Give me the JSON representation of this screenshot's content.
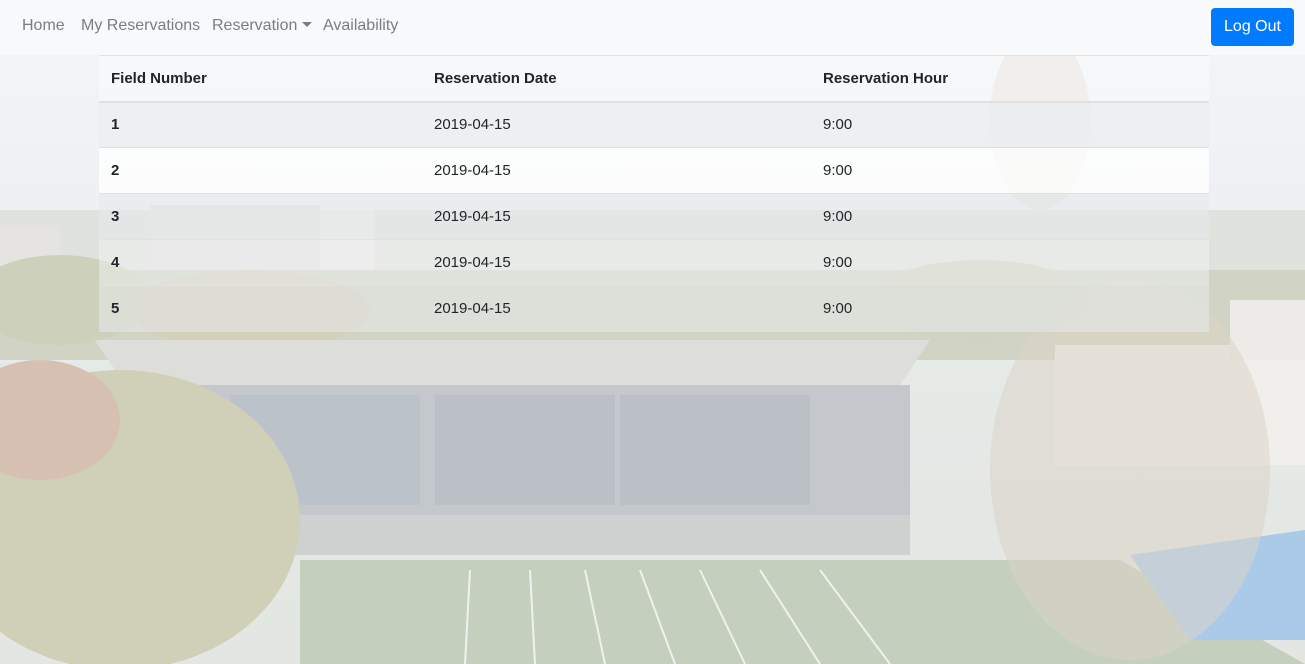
{
  "nav": {
    "home": "Home",
    "my_reservations": "My Reservations",
    "reservation": "Reservation",
    "availability": "Availability",
    "logout": "Log Out"
  },
  "table": {
    "headers": [
      "Field Number",
      "Reservation Date",
      "Reservation Hour"
    ],
    "rows": [
      [
        "1",
        "2019-04-15",
        "9:00"
      ],
      [
        "2",
        "2019-04-15",
        "9:00"
      ],
      [
        "3",
        "2019-04-15",
        "9:00"
      ],
      [
        "4",
        "2019-04-15",
        "9:00"
      ],
      [
        "5",
        "2019-04-15",
        "9:00"
      ]
    ]
  },
  "colors": {
    "accent": "#007bff",
    "navbar_bg": "#f8f9fa",
    "nav_text": "#7a7e82"
  }
}
